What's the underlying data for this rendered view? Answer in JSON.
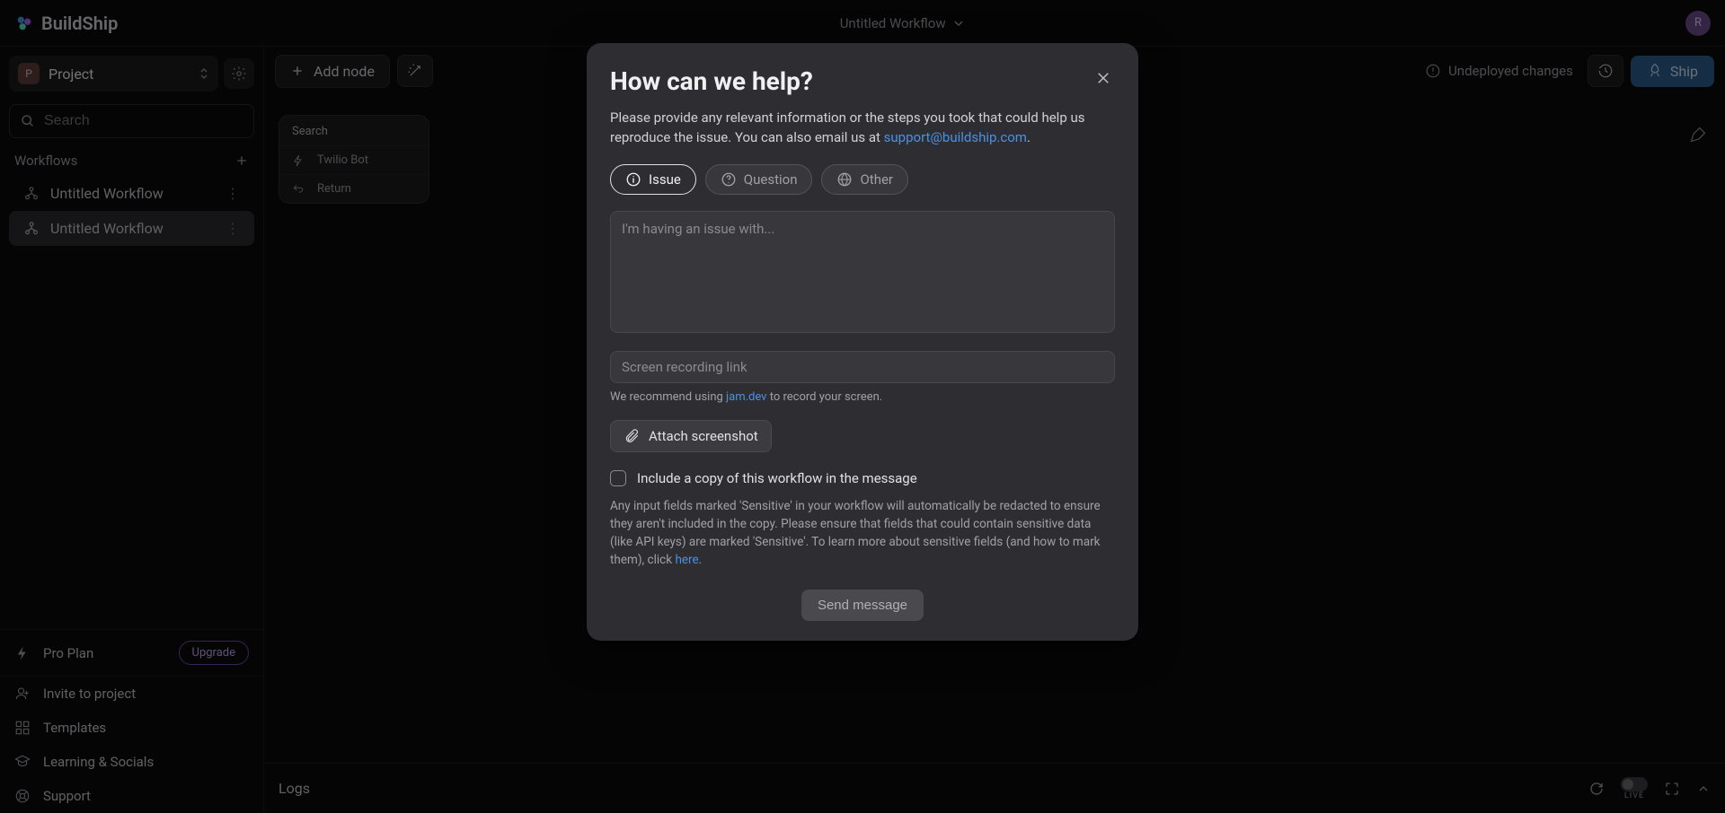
{
  "topbar": {
    "brand": "BuildShip",
    "workflow_title": "Untitled Workflow",
    "avatar_letter": "R"
  },
  "sidebar": {
    "project_letter": "P",
    "project_name": "Project",
    "search_placeholder": "Search",
    "workflows_header": "Workflows",
    "workflows": [
      {
        "label": "Untitled Workflow",
        "selected": false
      },
      {
        "label": "Untitled Workflow",
        "selected": true
      }
    ],
    "pro_plan": "Pro Plan",
    "upgrade": "Upgrade",
    "footer": {
      "invite": "Invite to project",
      "templates": "Templates",
      "learning": "Learning & Socials",
      "support": "Support"
    }
  },
  "toolbar": {
    "add_node": "Add node",
    "undeployed": "Undeployed changes",
    "ship": "Ship"
  },
  "canvas": {
    "card_header": "Search",
    "card_row1": "Twilio Bot",
    "card_row2": "Return"
  },
  "logs": {
    "label": "Logs",
    "live": "LIVE"
  },
  "modal": {
    "title": "How can we help?",
    "desc_pre": "Please provide any relevant information or the steps you took that could help us reproduce the issue. You can also email us at ",
    "desc_link": "support@buildship.com",
    "desc_post": ".",
    "types": {
      "issue": "Issue",
      "question": "Question",
      "other": "Other"
    },
    "issue_placeholder": "I'm having an issue with...",
    "link_placeholder": "Screen recording link",
    "hint_pre": "We recommend using ",
    "hint_link": "jam.dev",
    "hint_post": " to record your screen.",
    "attach": "Attach screenshot",
    "include_copy": "Include a copy of this workflow in the message",
    "disclaimer_pre": "Any input fields marked 'Sensitive' in your workflow will automatically be redacted to ensure they aren't included in the copy. Please ensure that fields that could contain sensitive data (like API keys) are marked 'Sensitive'. To learn more about sensitive fields (and how to mark them), click ",
    "disclaimer_link": "here",
    "disclaimer_post": ".",
    "send": "Send message"
  }
}
